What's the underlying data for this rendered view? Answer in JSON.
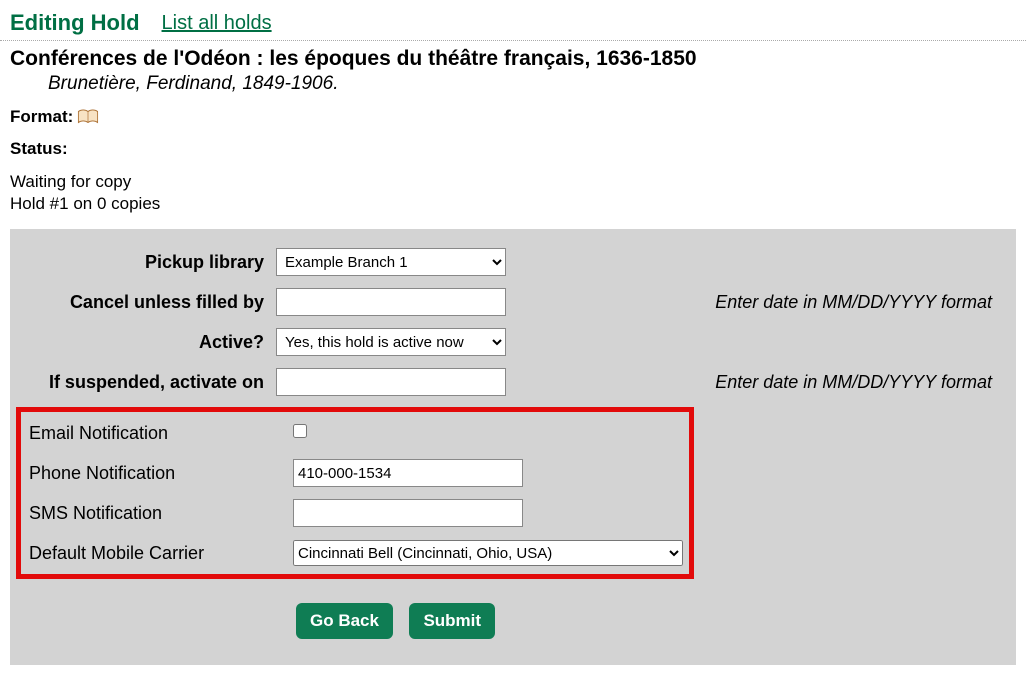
{
  "header": {
    "editing_label": "Editing Hold",
    "list_link": "List all holds"
  },
  "record": {
    "title": "Conférences de l'Odéon : les époques du théâtre français, 1636-1850",
    "author": "Brunetière, Ferdinand, 1849-1906.",
    "format_label": "Format:",
    "status_label": "Status:",
    "status_text1": "Waiting for copy",
    "status_text2": "Hold #1 on 0 copies"
  },
  "form": {
    "pickup_label": "Pickup library",
    "pickup_value": "Example Branch 1",
    "cancel_label": "Cancel unless filled by",
    "cancel_value": "",
    "date_hint": "Enter date in MM/DD/YYYY format",
    "active_label": "Active?",
    "active_value": "Yes, this hold is active now",
    "suspend_label": "If suspended, activate on",
    "suspend_value": "",
    "email_label": "Email Notification",
    "phone_label": "Phone Notification",
    "phone_value": "410-000-1534",
    "sms_label": "SMS Notification",
    "sms_value": "",
    "carrier_label": "Default Mobile Carrier",
    "carrier_value": "Cincinnati Bell (Cincinnati, Ohio, USA)"
  },
  "buttons": {
    "go_back": "Go Back",
    "submit": "Submit"
  }
}
